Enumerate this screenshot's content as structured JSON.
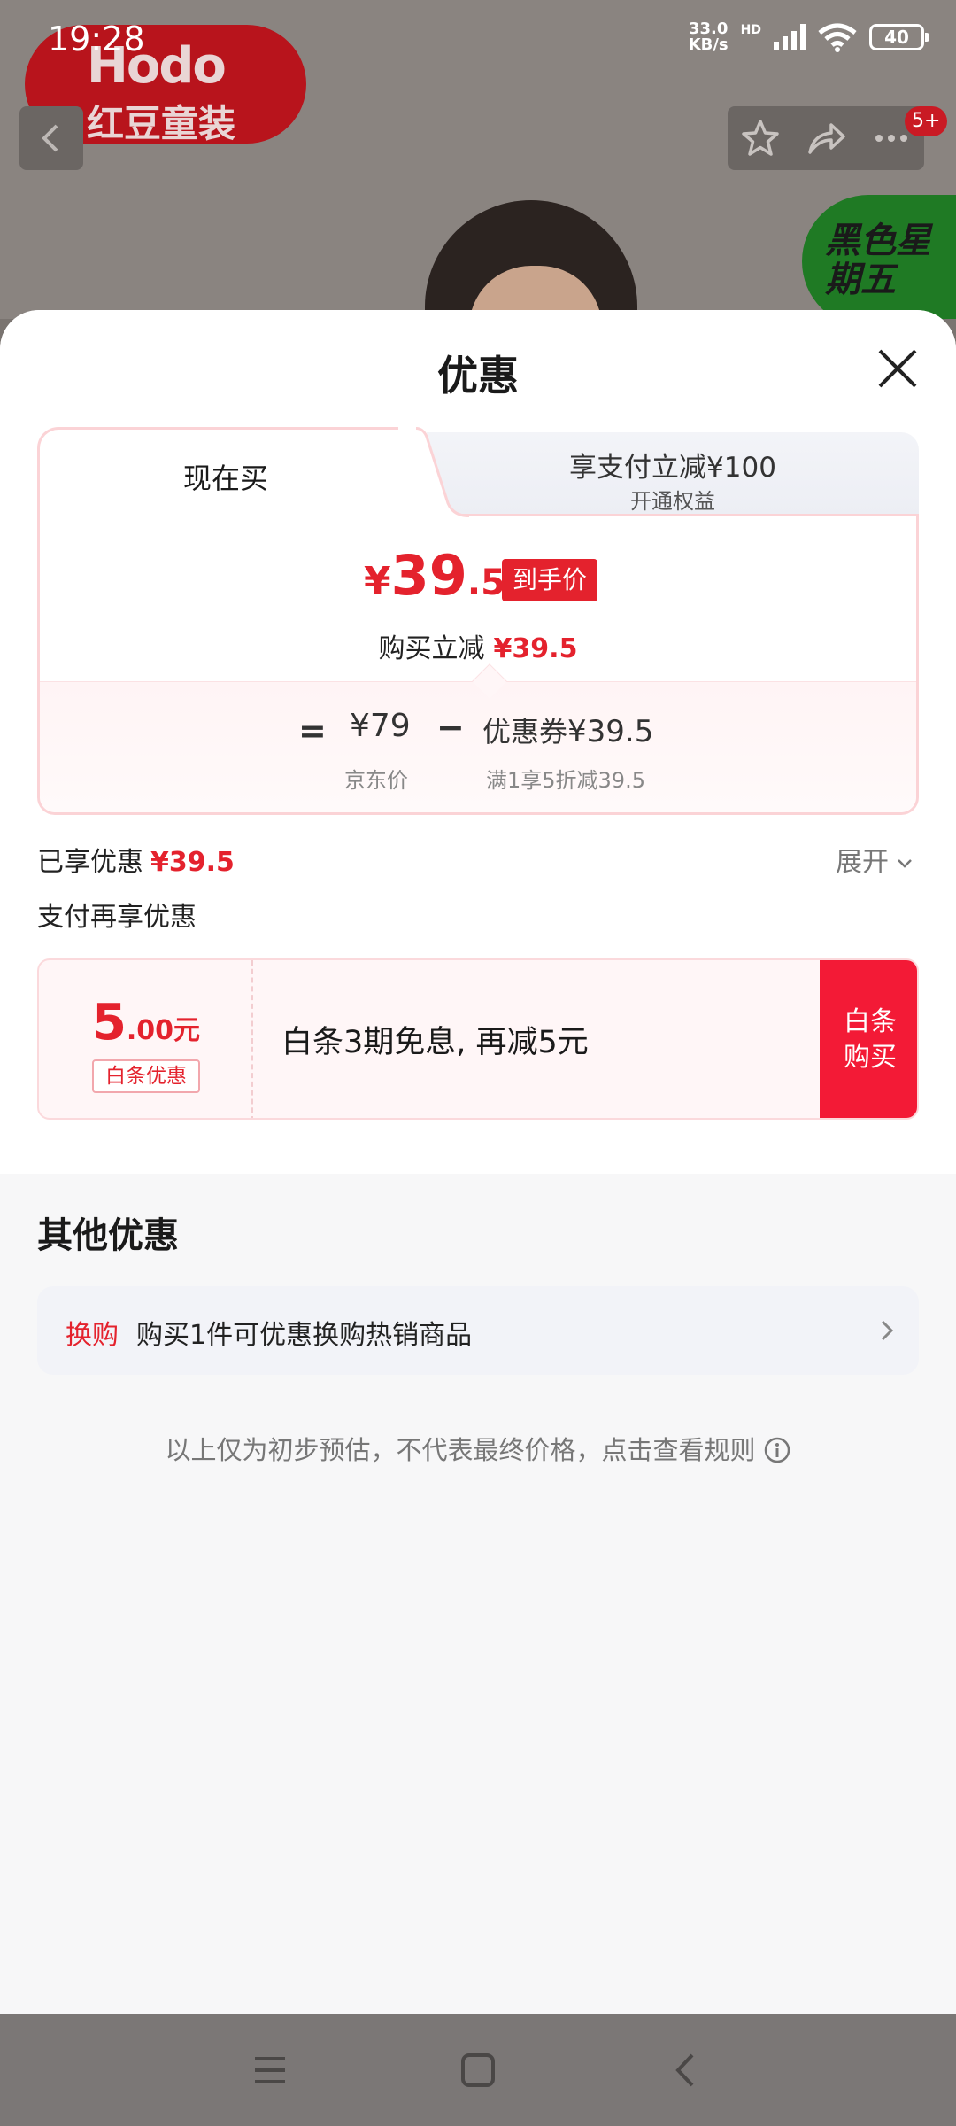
{
  "status_bar": {
    "time": "19:28",
    "net_speed_value": "33.0",
    "net_speed_unit": "KB/s",
    "hd_label": "HD",
    "battery": "40"
  },
  "background_page": {
    "brand_logo_en": "Hodo",
    "brand_logo_cn": "红豆童装",
    "promo_badge": "黑色星期五",
    "notification_badge": "5+"
  },
  "sheet": {
    "title": "优惠",
    "tabs": [
      {
        "label": "现在买",
        "active": true
      },
      {
        "label": "享支付立减¥100",
        "sublabel": "开通权益",
        "active": false
      }
    ],
    "final_price": {
      "currency": "¥",
      "integer": "39",
      "decimal": ".5",
      "tag": "到手价"
    },
    "reduce_label": "购买立减",
    "reduce_amount": "¥39.5",
    "formula": {
      "equals": "=",
      "jd_price": "¥79",
      "jd_price_label": "京东价",
      "minus": "−",
      "coupon_label": "优惠券",
      "coupon_value": "¥39.5",
      "coupon_desc": "满1享5折减39.5"
    },
    "enjoyed_label": "已享优惠",
    "enjoyed_amount": "¥39.5",
    "expand_label": "展开",
    "pay_more_label": "支付再享优惠",
    "baitiao": {
      "amount_big": "5",
      "amount_small": ".00元",
      "tag": "白条优惠",
      "text": "白条3期免息, 再减5元",
      "buy_line1": "白条",
      "buy_line2": "购买"
    },
    "other_title": "其他优惠",
    "other_row": {
      "tag": "换购",
      "text": "购买1件可优惠换购热销商品"
    },
    "disclaimer": "以上仅为初步预估，不代表最终价格，点击查看规则"
  },
  "colors": {
    "accent_red": "#e4222d",
    "buy_button": "#f31a36",
    "card_border": "#fbd3d6"
  },
  "icons": [
    "back-icon",
    "star-icon",
    "share-icon",
    "more-icon",
    "close-icon",
    "chevron-down-icon",
    "chevron-right-icon",
    "info-icon",
    "menu-icon",
    "home-icon",
    "nav-back-icon"
  ]
}
